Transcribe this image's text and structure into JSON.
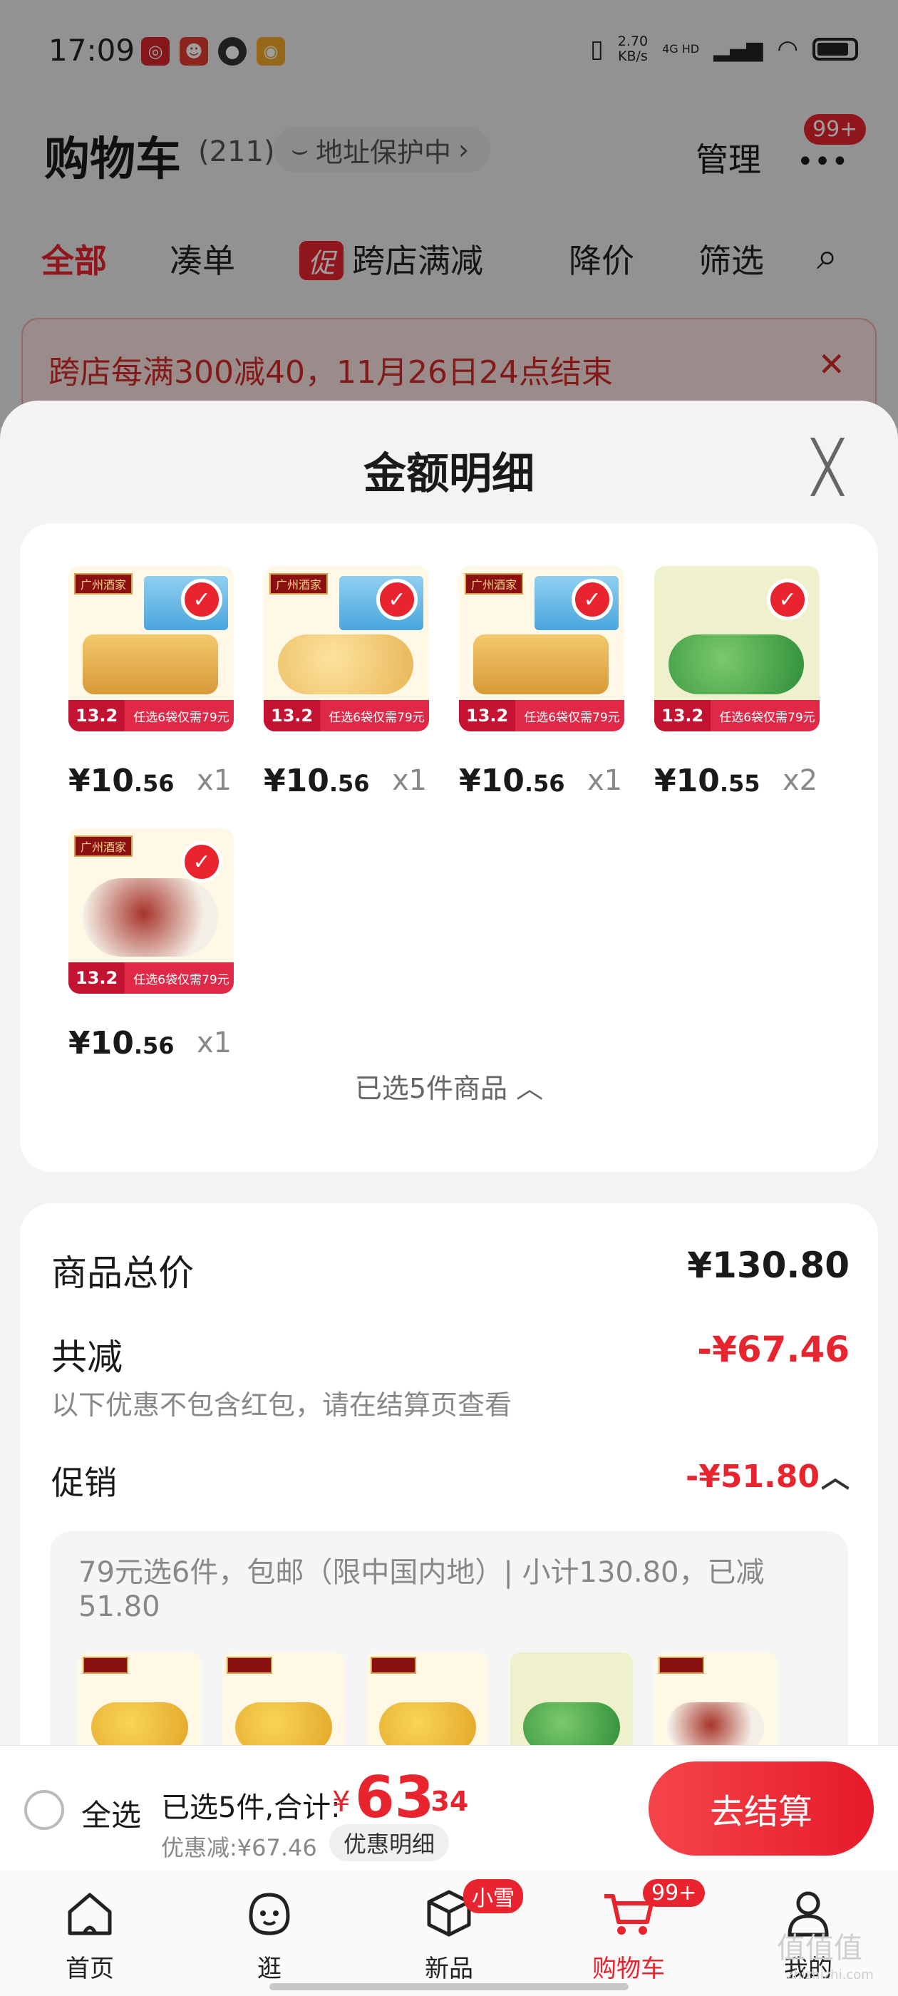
{
  "status_bar": {
    "time": "17:09",
    "net_speed_value": "2.70",
    "net_speed_unit": "KB/s",
    "signal_label": "4G HD"
  },
  "header": {
    "title": "购物车",
    "count": "(211)",
    "address_chip": "地址保护中",
    "manage_label": "管理",
    "more_badge": "99+"
  },
  "filter_tabs": {
    "all": "全部",
    "combine": "凑单",
    "promo_tag": "促",
    "cross_store": "跨店满减",
    "price_drop": "降价",
    "filter": "筛选"
  },
  "promo_banner": {
    "text": "跨店每满300减40，11月26日24点结束"
  },
  "sheet": {
    "title": "金额明细",
    "items": [
      {
        "price_yen": "¥",
        "price_int": "10",
        "price_dec": ".56",
        "qty": "x1"
      },
      {
        "price_yen": "¥",
        "price_int": "10",
        "price_dec": ".56",
        "qty": "x1"
      },
      {
        "price_yen": "¥",
        "price_int": "10",
        "price_dec": ".56",
        "qty": "x1"
      },
      {
        "price_yen": "¥",
        "price_int": "10",
        "price_dec": ".55",
        "qty": "x2"
      },
      {
        "price_yen": "¥",
        "price_int": "10",
        "price_dec": ".56",
        "qty": "x1"
      }
    ],
    "thumb_brand": "广州酒家",
    "thumb_price": "13.2",
    "thumb_offer": "任选6袋仅需79元",
    "selected_summary": "已选5件商品"
  },
  "details": {
    "subtotal_label": "商品总价",
    "subtotal_value": "¥130.80",
    "total_discount_label": "共减",
    "total_discount_value": "-¥67.46",
    "discount_note": "以下优惠不包含红包，请在结算页查看",
    "promo_label": "促销",
    "promo_value": "-¥51.80",
    "promo_rule": "79元选6件，包邮（限中国内地）| 小计130.80，已减51.80"
  },
  "checkout": {
    "select_all": "全选",
    "total_label": "已选5件,合计:",
    "total_yen": "¥",
    "total_int": "63",
    "total_dec": ".34",
    "discount_line": "优惠减:¥67.46",
    "discount_detail_chip": "优惠明细",
    "checkout_button": "去结算"
  },
  "tabbar": {
    "home": "首页",
    "explore": "逛",
    "new": "新品",
    "new_badge": "小雪",
    "cart": "购物车",
    "cart_badge": "99+",
    "mine": "我的"
  },
  "watermark": {
    "main": "值值值",
    "sub": "zhizhizhi.com"
  },
  "colors": {
    "accent": "#e8242f",
    "sheet_bg": "#f3f3f3",
    "card_bg": "#ffffff"
  }
}
